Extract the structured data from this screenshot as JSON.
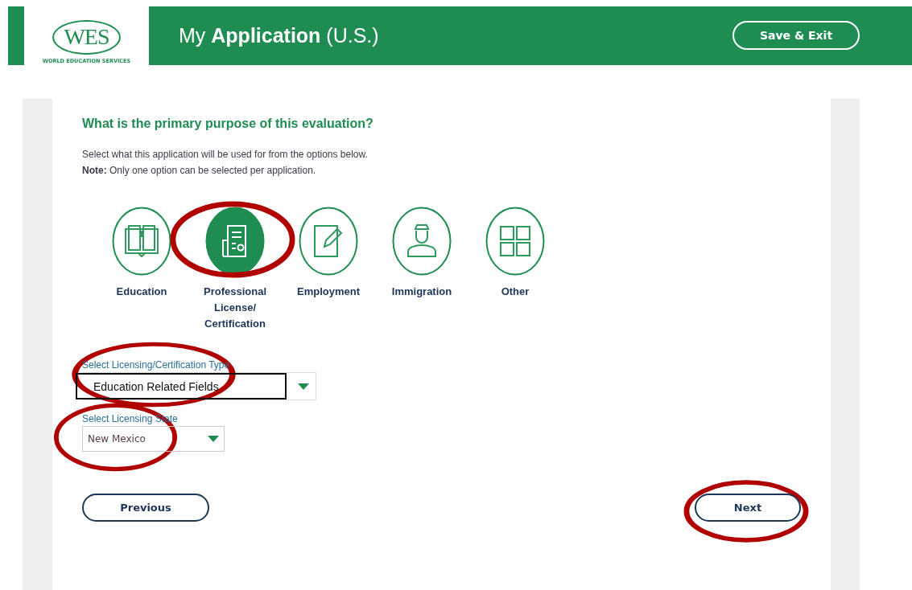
{
  "header": {
    "logo_mark": "WES",
    "logo_caption": "WORLD EDUCATION SERVICES",
    "title": "My **Application** (U.S.)",
    "save_button": "Save & Exit"
  },
  "question": "What is the primary purpose of this evaluation?",
  "intro": "Select what this application will be used for from the options below.",
  "note": "**Note:** Only one option can be selected per application.",
  "options": [
    {
      "label": "Education",
      "kind": "book",
      "selected": false,
      "circled": false
    },
    {
      "label": "Professional License/ Certification",
      "kind": "certificate",
      "selected": true,
      "circled": true
    },
    {
      "label": "Employment",
      "kind": "pencil",
      "selected": false,
      "circled": false
    },
    {
      "label": "Immigration",
      "kind": "officer",
      "selected": false,
      "circled": false
    },
    {
      "label": "Other",
      "kind": "grid",
      "selected": false,
      "circled": false
    }
  ],
  "fields": [
    {
      "label": "Select Licensing/Certification Type",
      "value": "Education Related Fields",
      "kind": "outlined",
      "circled": true
    },
    {
      "label": "Select Licensing State",
      "value": "New Mexico",
      "kind": "plain",
      "circled": true
    }
  ],
  "buttons": [
    {
      "label": "Previous",
      "kind": "previous",
      "circled": false
    },
    {
      "label": "Next",
      "kind": "next",
      "circled": true
    }
  ]
}
